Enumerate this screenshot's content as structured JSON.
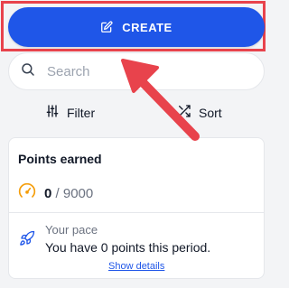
{
  "create": {
    "label": "CREATE",
    "icon": "edit-icon"
  },
  "search": {
    "placeholder": "Search",
    "value": ""
  },
  "toolbar": {
    "filter_label": "Filter",
    "sort_label": "Sort"
  },
  "points_card": {
    "title": "Points earned",
    "earned": "0",
    "separator": "/",
    "goal": "9000",
    "pace_label": "Your pace",
    "pace_text": "You have 0 points this period.",
    "show_details": "Show details"
  },
  "colors": {
    "primary": "#1f56e8",
    "highlight": "#e8434c",
    "gauge": "#f59e0b",
    "rocket": "#1f56e8"
  }
}
